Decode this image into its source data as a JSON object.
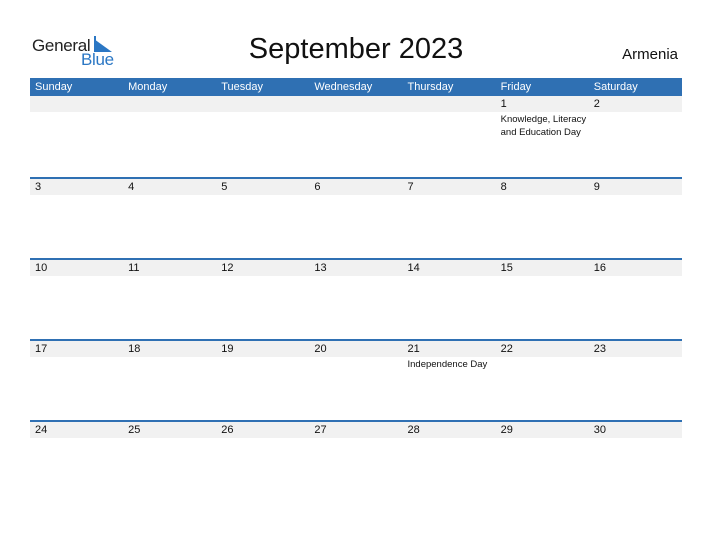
{
  "logo": {
    "general": "General",
    "blue": "Blue"
  },
  "title": "September 2023",
  "country": "Armenia",
  "weekdays": [
    "Sunday",
    "Monday",
    "Tuesday",
    "Wednesday",
    "Thursday",
    "Friday",
    "Saturday"
  ],
  "weeks": [
    {
      "dates": [
        "",
        "",
        "",
        "",
        "",
        "1",
        "2"
      ],
      "events": [
        "",
        "",
        "",
        "",
        "",
        "Knowledge, Literacy and Education Day",
        ""
      ]
    },
    {
      "dates": [
        "3",
        "4",
        "5",
        "6",
        "7",
        "8",
        "9"
      ],
      "events": [
        "",
        "",
        "",
        "",
        "",
        "",
        ""
      ]
    },
    {
      "dates": [
        "10",
        "11",
        "12",
        "13",
        "14",
        "15",
        "16"
      ],
      "events": [
        "",
        "",
        "",
        "",
        "",
        "",
        ""
      ]
    },
    {
      "dates": [
        "17",
        "18",
        "19",
        "20",
        "21",
        "22",
        "23"
      ],
      "events": [
        "",
        "",
        "",
        "",
        "Independence Day",
        "",
        ""
      ]
    },
    {
      "dates": [
        "24",
        "25",
        "26",
        "27",
        "28",
        "29",
        "30"
      ],
      "events": [
        "",
        "",
        "",
        "",
        "",
        "",
        ""
      ]
    }
  ],
  "colors": {
    "accent": "#2f70b3",
    "date_row_bg": "#f1f1f1",
    "logo_blue": "#2b77c4"
  }
}
